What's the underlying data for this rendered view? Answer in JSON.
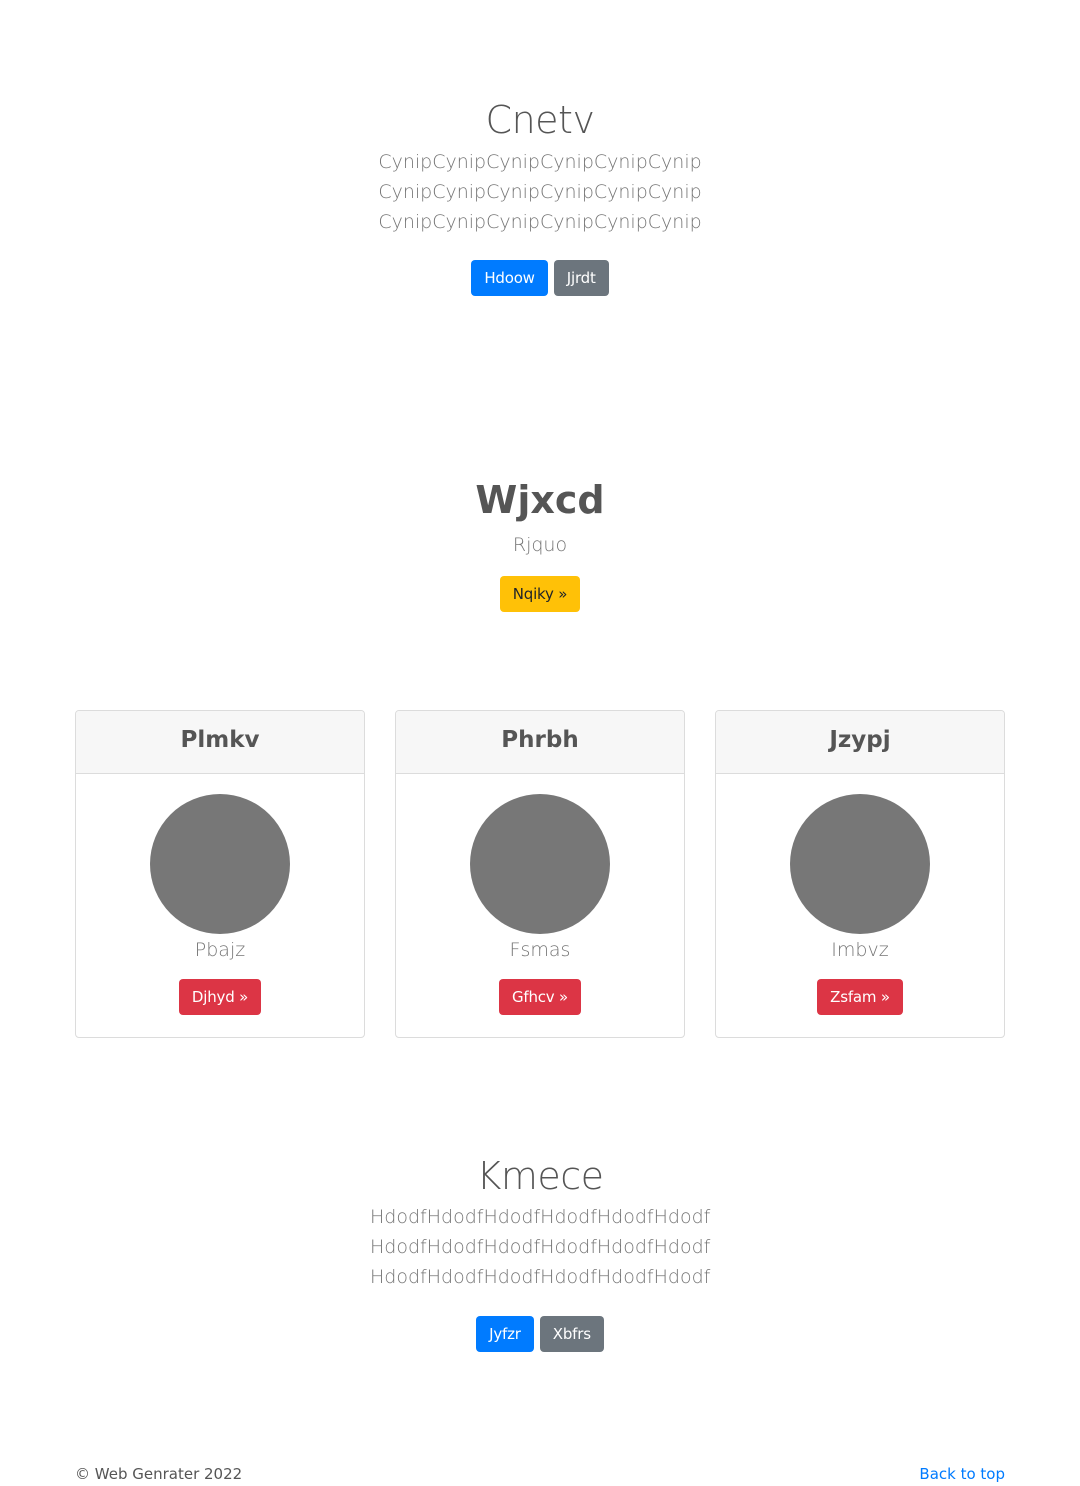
{
  "hero1": {
    "title": "Cnetv",
    "lead": "CynipCynipCynipCynipCynipCynip CynipCynipCynipCynipCynipCynip CynipCynipCynipCynipCynipCynip",
    "primary_btn": "Hdoow",
    "secondary_btn": "Jjrdt"
  },
  "feature": {
    "title": "Wjxcd",
    "subtitle": "Rjquo",
    "btn": "Nqiky »"
  },
  "cards": [
    {
      "header": "Plmkv",
      "name": "Pbajz",
      "btn": "Djhyd »"
    },
    {
      "header": "Phrbh",
      "name": "Fsmas",
      "btn": "Gfhcv »"
    },
    {
      "header": "Jzypj",
      "name": "Imbvz",
      "btn": "Zsfam »"
    }
  ],
  "hero2": {
    "title": "Kmece",
    "lead": "HdodfHdodfHdodfHdodfHdodfHdodf HdodfHdodfHdodfHdodfHdodfHdodf HdodfHdodfHdodfHdodfHdodfHdodf",
    "primary_btn": "Jyfzr",
    "secondary_btn": "Xbfrs"
  },
  "footer": {
    "copyright": "© Web Genrater 2022",
    "back_to_top": "Back to top"
  },
  "colors": {
    "primary": "#007bff",
    "secondary": "#6c757d",
    "warning": "#ffc107",
    "danger": "#dc3545",
    "avatar": "#777777"
  }
}
